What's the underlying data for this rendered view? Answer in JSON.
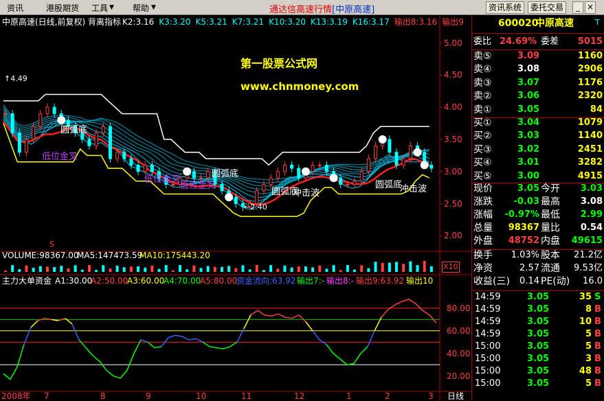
{
  "menu": {
    "items": [
      "资讯",
      "港股期货",
      "工具",
      "帮助"
    ],
    "title": "通达信高速行情",
    "title_tag": "[中原高速]",
    "buttons": [
      "资讯系统",
      "委托交易"
    ]
  },
  "chart_header": {
    "name": "中原高速(日线,前复权) 背离指标",
    "k_items": [
      {
        "label": "K2:3.16",
        "color": "#ffffff"
      },
      {
        "label": "K3:3.20",
        "color": "#00ffff"
      },
      {
        "label": "K5:3.21",
        "color": "#00ffff"
      },
      {
        "label": "K7:3.21",
        "color": "#00ffff"
      },
      {
        "label": "K10:3.20",
        "color": "#00ffff"
      },
      {
        "label": "K13:3.19",
        "color": "#00ffff"
      },
      {
        "label": "K16:3.17",
        "color": "#00ffff"
      },
      {
        "label": "输出8:3.16",
        "color": "#ff4040"
      },
      {
        "label": "输出9",
        "color": "#ff4040"
      }
    ]
  },
  "watermark": {
    "line1": "第一股票公式网",
    "line2": "www.chnmoney.com"
  },
  "price_axis": [
    "5.00",
    "4.50",
    "4.00",
    "3.50",
    "3.00",
    "2.50",
    "2.00"
  ],
  "annotations": {
    "high_value": "4.49",
    "low_value": "2.40",
    "yuanhudi": "圆弧底",
    "diwei_jincha": "低位金叉",
    "chongji_bo": "冲击波",
    "mark_s": "S"
  },
  "volume_header": {
    "vol": "VOLUME:98367.00",
    "ma5": "MA5:147473.59",
    "ma10": "MA10:175443.20",
    "scale": "X10"
  },
  "indicator_header": {
    "name": "主力大单资金",
    "a1": "A1:30.00",
    "a2": "A2:50.00",
    "a3": "A3:60.00",
    "a4": "A4:70.00",
    "a5": "A5:80.00",
    "fund": "资金流向:63.92",
    "out7": "输出7:-",
    "out8": "输出8:-",
    "out9": "输出9:63.92",
    "out10": "输出10"
  },
  "indicator_axis": [
    "80.00",
    "60.00",
    "40.00",
    "20.00"
  ],
  "date_axis": {
    "year": "2008年",
    "months": [
      "7",
      "8",
      "9",
      "10",
      "11",
      "12",
      "1",
      "2",
      "3"
    ],
    "period": "日线"
  },
  "chart_data": {
    "type": "line",
    "price_ylim": [
      1.8,
      5.2
    ],
    "price_path": [
      3.9,
      3.6,
      3.3,
      3.5,
      3.7,
      3.9,
      4.0,
      3.9,
      3.8,
      3.7,
      3.6,
      3.5,
      3.4,
      3.6,
      3.7,
      3.2,
      3.3,
      3.2,
      3.1,
      3.0,
      3.1,
      3.0,
      2.9,
      2.8,
      2.8,
      2.9,
      3.0,
      2.9,
      2.9,
      3.0,
      2.8,
      2.7,
      2.6,
      2.5,
      2.45,
      2.5,
      2.7,
      2.8,
      2.9,
      3.0,
      3.1,
      3.05,
      2.9,
      3.0,
      3.1,
      3.1,
      3.0,
      2.9,
      2.8,
      2.8,
      2.85,
      3.0,
      3.2,
      3.4,
      3.5,
      3.3,
      3.1,
      3.2,
      3.4,
      3.3,
      3.1,
      3.05
    ],
    "indicator_ylim": [
      10,
      100
    ],
    "indicator_values": [
      22,
      17,
      28,
      48,
      63,
      69,
      71,
      70,
      69,
      71,
      66,
      52,
      45,
      38,
      33,
      25,
      20,
      18,
      25,
      40,
      52,
      50,
      45,
      46,
      54,
      56,
      55,
      52,
      53,
      50,
      46,
      45,
      44,
      46,
      50,
      62,
      74,
      78,
      74,
      73,
      75,
      72,
      71,
      74,
      68,
      60,
      52,
      48,
      40,
      35,
      30,
      31,
      40,
      46,
      60,
      72,
      79,
      83,
      86,
      88,
      84,
      78,
      74,
      67
    ],
    "levels": {
      "A1": 30,
      "A2": 50,
      "A3": 60,
      "A4": 70,
      "A5": 80
    }
  },
  "quote": {
    "code": "600020",
    "name": "中原高速",
    "flag": "T",
    "weibi_label": "委比",
    "weibi": "24.69%",
    "weicha_label": "委差",
    "weicha": "5015",
    "sell": [
      {
        "label": "卖⑤",
        "price": "3.09",
        "vol": "1160",
        "pc": "#ff4040"
      },
      {
        "label": "卖④",
        "price": "3.08",
        "vol": "2906",
        "pc": "#ffffff"
      },
      {
        "label": "卖③",
        "price": "3.07",
        "vol": "1176",
        "pc": "#00ff00"
      },
      {
        "label": "卖②",
        "price": "3.06",
        "vol": "2320",
        "pc": "#00ff00"
      },
      {
        "label": "卖①",
        "price": "3.05",
        "vol": "84",
        "pc": "#00ff00"
      }
    ],
    "buy": [
      {
        "label": "买①",
        "price": "3.04",
        "vol": "1079",
        "pc": "#00ff00"
      },
      {
        "label": "买②",
        "price": "3.03",
        "vol": "1140",
        "pc": "#00ff00"
      },
      {
        "label": "买③",
        "price": "3.02",
        "vol": "2451",
        "pc": "#00ff00"
      },
      {
        "label": "买④",
        "price": "3.01",
        "vol": "3282",
        "pc": "#00ff00"
      },
      {
        "label": "买⑤",
        "price": "3.00",
        "vol": "4915",
        "pc": "#00ff00"
      }
    ],
    "stats": [
      {
        "l1": "现价",
        "v1": "3.05",
        "c1": "#00ff00",
        "l2": "今开",
        "v2": "3.03",
        "c2": "#00ff00"
      },
      {
        "l1": "涨跌",
        "v1": "-0.03",
        "c1": "#00ff00",
        "l2": "最高",
        "v2": "3.08",
        "c2": "#ffffff"
      },
      {
        "l1": "涨幅",
        "v1": "-0.97%",
        "c1": "#00ff00",
        "l2": "最低",
        "v2": "2.99",
        "c2": "#00ff00"
      },
      {
        "l1": "总量",
        "v1": "98367",
        "c1": "#ffff00",
        "l2": "量比",
        "v2": "0.54",
        "c2": "#ffffff"
      },
      {
        "l1": "外盘",
        "v1": "48752",
        "c1": "#ff4040",
        "l2": "内盘",
        "v2": "49615",
        "c2": "#00ff00"
      }
    ],
    "stats2": [
      {
        "l1": "换手",
        "v1": "1.03%",
        "l2": "股本",
        "v2": "21.2亿"
      },
      {
        "l1": "净资",
        "v1": "2.57",
        "l2": "流通",
        "v2": "9.53亿"
      },
      {
        "l1": "收益(三)",
        "v1": "0.14",
        "l2": "PE(动)",
        "v2": "16.0"
      }
    ],
    "ticks": [
      {
        "t": "14:59",
        "p": "3.05",
        "v": "35",
        "s": "S",
        "sc": "#00ff00"
      },
      {
        "t": "14:59",
        "p": "3.05",
        "v": "8",
        "s": "B",
        "sc": "#ff4040"
      },
      {
        "t": "14:59",
        "p": "3.05",
        "v": "10",
        "s": "B",
        "sc": "#ff4040"
      },
      {
        "t": "14:59",
        "p": "3.05",
        "v": "5",
        "s": "B",
        "sc": "#ff4040"
      },
      {
        "t": "15:00",
        "p": "3.05",
        "v": "5",
        "s": "B",
        "sc": "#ff4040"
      },
      {
        "t": "15:00",
        "p": "3.05",
        "v": "3",
        "s": "B",
        "sc": "#ff4040"
      },
      {
        "t": "15:00",
        "p": "3.05",
        "v": "48",
        "s": "B",
        "sc": "#ff4040"
      },
      {
        "t": "15:00",
        "p": "3.05",
        "v": "5",
        "s": "B",
        "sc": "#ff4040"
      }
    ]
  }
}
